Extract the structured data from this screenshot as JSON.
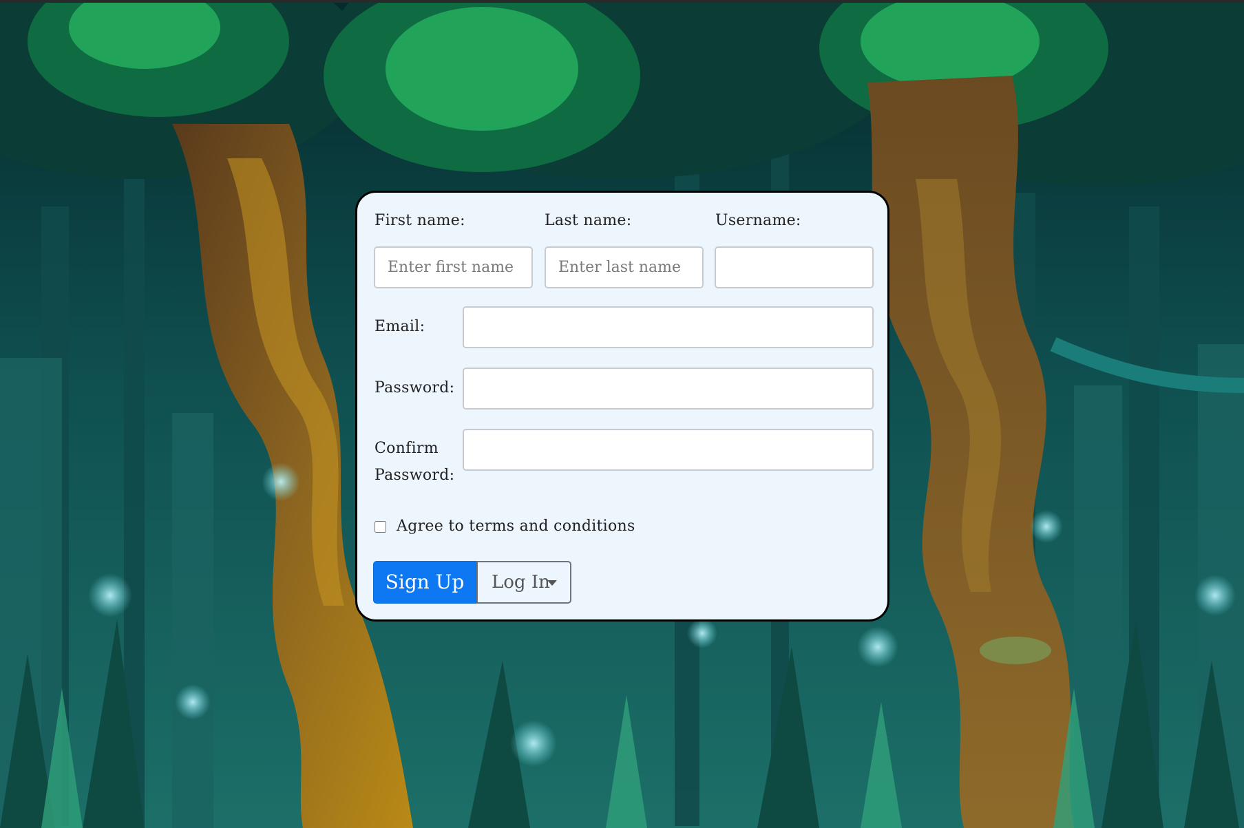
{
  "form": {
    "first_name_label": "First name:",
    "first_name_placeholder": "Enter first name",
    "first_name_value": "",
    "last_name_label": "Last name:",
    "last_name_placeholder": "Enter last name",
    "last_name_value": "",
    "username_label": "Username:",
    "username_value": "",
    "email_label": "Email:",
    "email_value": "",
    "password_label": "Password:",
    "password_value": "",
    "confirm_label_line1": "Confirm",
    "confirm_label_line2": "Password:",
    "confirm_value": "",
    "terms_label": "Agree to terms and conditions",
    "terms_checked": false
  },
  "buttons": {
    "signup_label": "Sign Up",
    "login_label": "Log In"
  },
  "icons": {
    "login_dropdown": "caret-down-icon"
  },
  "colors": {
    "primary_button": "#0d78f2",
    "card_background": "#eef6fd",
    "card_border": "#000000"
  }
}
